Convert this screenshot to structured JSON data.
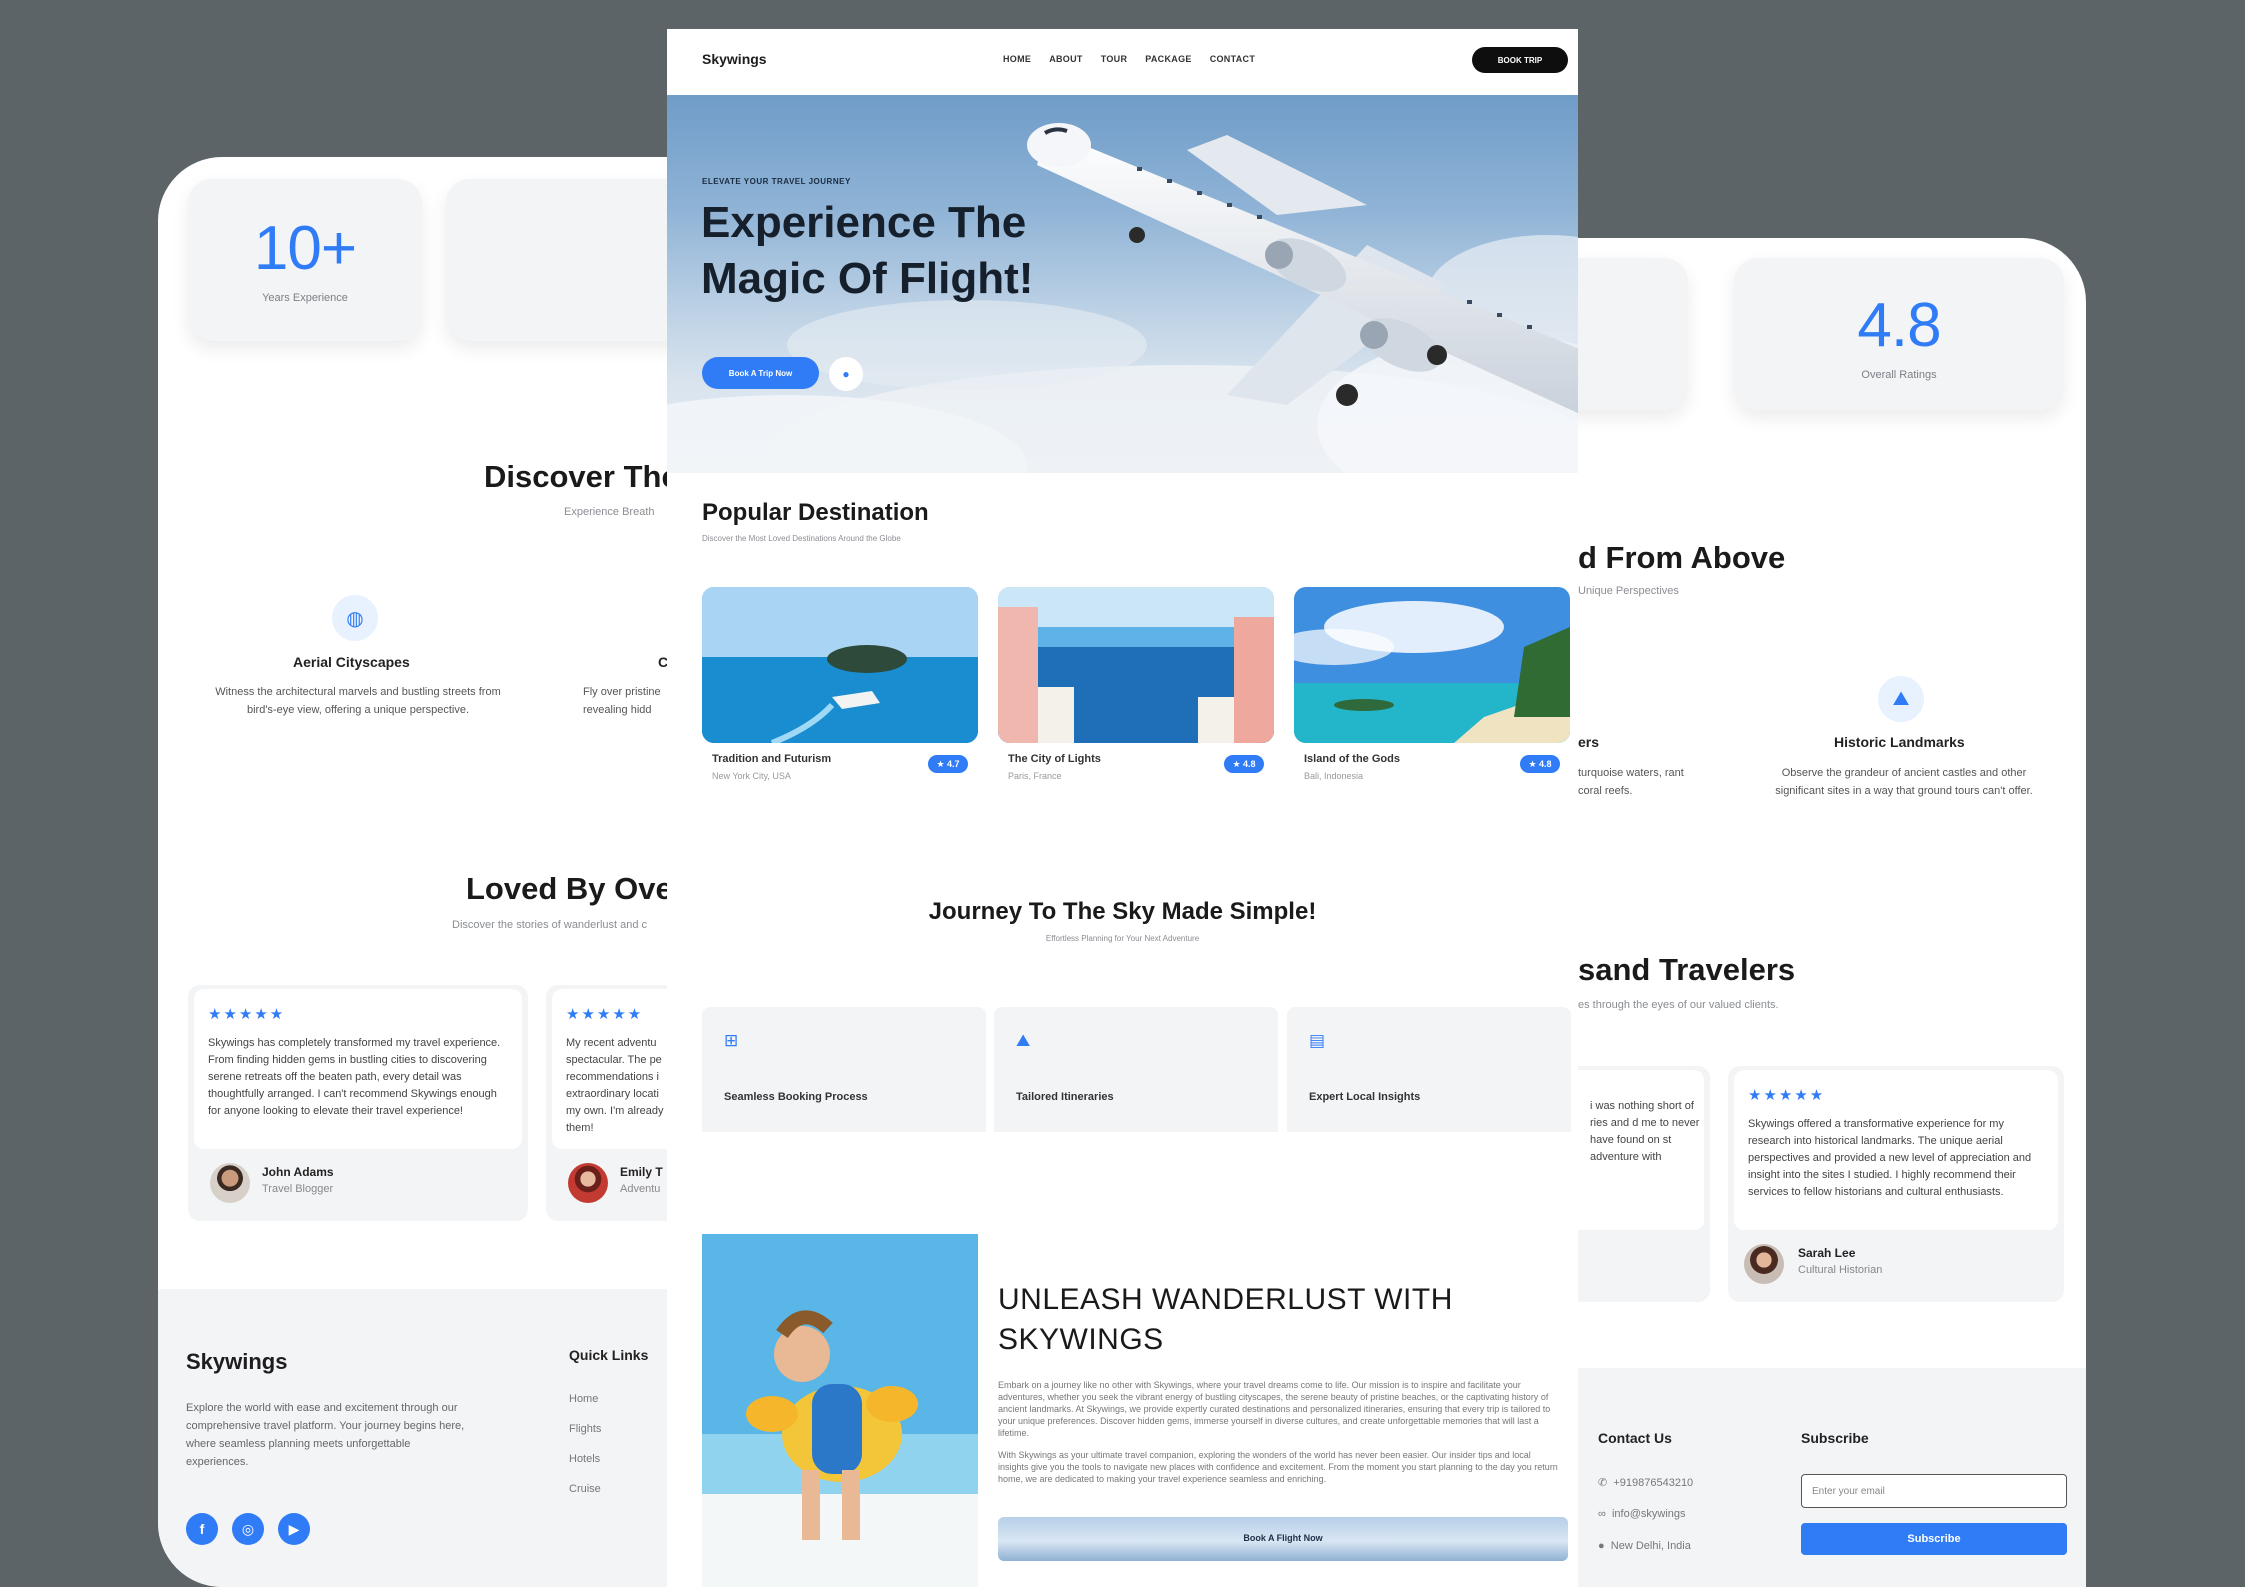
{
  "brand": "Skywings",
  "nav": {
    "links": [
      "HOME",
      "ABOUT",
      "TOUR",
      "PACKAGE",
      "CONTACT"
    ],
    "book_button": "BOOK TRIP"
  },
  "hero": {
    "eyebrow": "ELEVATE YOUR TRAVEL JOURNEY",
    "title": "Experience The Magic Of Flight!",
    "cta": "Book A Trip Now"
  },
  "stats": [
    {
      "value": "10+",
      "label": "Years Experience"
    },
    {
      "value": "4.8",
      "label": "Overall Ratings"
    }
  ],
  "discover": {
    "title_left": "Discover The",
    "subtitle_left": "Experience Breath",
    "title_right": "d From Above",
    "subtitle_right": "Unique Perspectives",
    "features": [
      {
        "title": "Aerial Cityscapes",
        "desc": "Witness the architectural marvels and bustling streets from bird's-eye view, offering a unique perspective."
      },
      {
        "title": "C",
        "desc": "Fly over pristine revealing hidd"
      },
      {
        "title": "ers",
        "desc": "turquoise waters, rant coral reefs."
      },
      {
        "title": "Historic Landmarks",
        "desc": "Observe the grandeur of ancient castles and other significant sites in a way that ground tours can't offer."
      }
    ]
  },
  "popular": {
    "title": "Popular Destination",
    "subtitle": "Discover the Most Loved Destinations Around the Globe",
    "destinations": [
      {
        "name": "Tradition and Futurism",
        "location": "New York City, USA",
        "rating": "★ 4.7"
      },
      {
        "name": "The City of Lights",
        "location": "Paris, France",
        "rating": "★ 4.8"
      },
      {
        "name": "Island of the Gods",
        "location": "Bali, Indonesia",
        "rating": "★ 4.8"
      }
    ]
  },
  "journey": {
    "title": "Journey To The Sky Made Simple!",
    "subtitle": "Effortless Planning for Your Next Adventure",
    "steps": [
      {
        "label": "Seamless Booking Process",
        "icon": "booking-icon"
      },
      {
        "label": "Tailored Itineraries",
        "icon": "mountain-icon"
      },
      {
        "label": "Expert Local Insights",
        "icon": "map-icon"
      }
    ]
  },
  "testimonials": {
    "title_left": "Loved By Over",
    "subtitle_left": "Discover the stories of wanderlust and c",
    "title_right": "sand Travelers",
    "subtitle_right": "es through the eyes of our valued clients.",
    "reviews": [
      {
        "stars": "★★★★★",
        "text": "Skywings has completely transformed my travel experience. From finding hidden gems in bustling cities to discovering serene retreats off the beaten path, every detail was thoughtfully arranged. I can't recommend Skywings enough for anyone looking to elevate their travel experience!",
        "name": "John Adams",
        "role": "Travel Blogger"
      },
      {
        "stars": "★★★★★",
        "text": "My recent adventu spectacular. The pe recommendations i extraordinary locati my own. I'm already them!",
        "name": "Emily T",
        "role": "Adventu"
      },
      {
        "stars": "",
        "text": "i was nothing short of ries and d me to never have found on st adventure with",
        "name": "",
        "role": ""
      },
      {
        "stars": "★★★★★",
        "text": "Skywings offered a transformative experience for my research into historical landmarks. The unique aerial perspectives and provided a new level of appreciation and insight into the sites I studied. I highly recommend their services to fellow historians and cultural enthusiasts.",
        "name": "Sarah Lee",
        "role": "Cultural Historian"
      }
    ]
  },
  "wanderlust": {
    "title": "UNLEASH WANDERLUST WITH SKYWINGS",
    "para1": "Embark on a journey like no other with Skywings, where your travel dreams come to life. Our mission is to inspire and facilitate your adventures, whether you seek the vibrant energy of bustling cityscapes, the serene beauty of pristine beaches, or the captivating history of ancient landmarks. At Skywings, we provide expertly curated destinations and personalized itineraries, ensuring that every trip is tailored to your unique preferences. Discover hidden gems, immerse yourself in diverse cultures, and create unforgettable memories that will last a lifetime.",
    "para2": "With Skywings as your ultimate travel companion, exploring the wonders of the world has never been easier. Our insider tips and local insights give you the tools to navigate new places with confidence and excitement. From the moment you start planning to the day you return home, we are dedicated to making your travel experience seamless and enriching.",
    "cta": "Book A Flight Now"
  },
  "footer": {
    "brand": "Skywings",
    "desc": "Explore the world with ease and excitement through our comprehensive travel platform. Your journey begins here, where seamless planning meets unforgettable experiences.",
    "quick_links_title": "Quick Links",
    "quick_links": [
      "Home",
      "Flights",
      "Hotels",
      "Cruise"
    ],
    "contact_title": "Contact Us",
    "contact": [
      "+919876543210",
      "info@skywings",
      "New Delhi, India"
    ],
    "subscribe_title": "Subscribe",
    "email_placeholder": "Enter your email",
    "subscribe_button": "Subscribe",
    "socials": [
      "facebook-icon",
      "instagram-icon",
      "youtube-icon"
    ]
  },
  "colors": {
    "accent": "#2f7cf6",
    "background": "#5c6468",
    "card": "#f3f4f6"
  }
}
